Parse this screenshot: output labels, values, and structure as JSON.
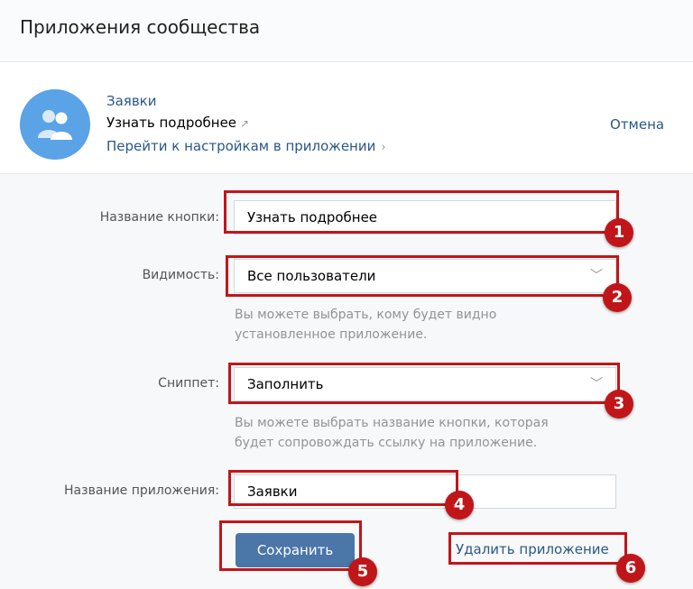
{
  "header": {
    "title": "Приложения сообщества"
  },
  "app": {
    "name": "Заявки",
    "learn_more": "Узнать подробнее",
    "learn_more_icon": "external-arrow-icon",
    "settings_link": "Перейти к настройкам в приложении",
    "settings_chevron": "›",
    "cancel": "Отмена",
    "avatar_icon": "users-icon",
    "avatar_color": "#5aa3e6"
  },
  "form": {
    "button_name_label": "Название кнопки:",
    "button_name_value": "Узнать подробнее",
    "visibility_label": "Видимость:",
    "visibility_value": "Все пользователи",
    "visibility_hint_1": "Вы можете выбрать, кому будет видно",
    "visibility_hint_2": "установленное приложение.",
    "snippet_label": "Сниппет:",
    "snippet_value": "Заполнить",
    "snippet_hint_1": "Вы можете выбрать название кнопки, которая",
    "snippet_hint_2": "будет сопровождать ссылку на приложение.",
    "app_name_label": "Название приложения:",
    "app_name_value": "Заявки",
    "save": "Сохранить",
    "delete": "Удалить приложение"
  },
  "badges": [
    "1",
    "2",
    "3",
    "4",
    "5",
    "6"
  ],
  "colors": {
    "accent": "#4a76a8",
    "link": "#2a5885",
    "highlight": "#c0161a"
  }
}
